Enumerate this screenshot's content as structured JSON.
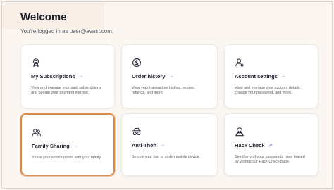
{
  "header": {
    "title": "Welcome",
    "subtitle": "You're logged in as user@avast.com."
  },
  "cards": [
    {
      "title": "My Subscriptions",
      "arrow": "→",
      "desc": "View and manage your paid subscriptions and update your payment method.",
      "icon": "award-badge-icon"
    },
    {
      "title": "Order history",
      "arrow": "→",
      "desc": "View your transaction history, request refunds, and more.",
      "icon": "dollar-circle-icon"
    },
    {
      "title": "Account settings",
      "arrow": "→",
      "desc": "View and manage your account details, change your password, and more.",
      "icon": "user-settings-icon"
    },
    {
      "title": "Family Sharing",
      "arrow": "→",
      "desc": "Share your subscriptions with your family.",
      "icon": "family-users-icon"
    },
    {
      "title": "Anti-Theft",
      "arrow": "→",
      "desc": "Secure your lost or stolen mobile device.",
      "icon": "spy-glasses-icon"
    },
    {
      "title": "Hack Check",
      "arrow": "↗",
      "desc": "See if any of your passwords have leaked by visiting our Hack Check page.",
      "icon": "hacker-icon"
    }
  ],
  "colors": {
    "accent_arrow": "#4a5ecf",
    "selected_outline": "#d98b4c",
    "background": "#fbf6f1"
  }
}
